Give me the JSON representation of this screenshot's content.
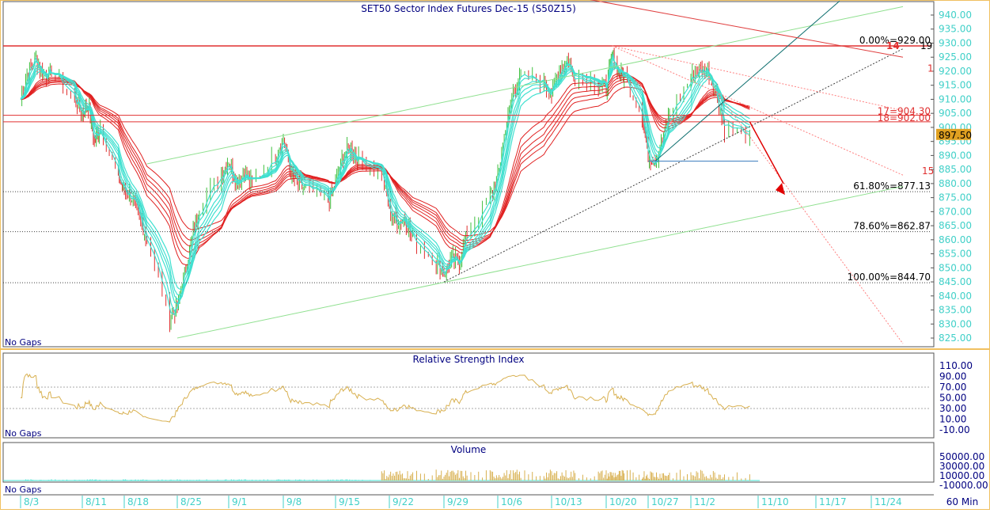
{
  "chart_data": [
    {
      "type": "line",
      "title": "SET50 Sector Index Futures Dec-15 (S50Z15)",
      "panel_note": "No Gaps",
      "timeframe": "60 Min",
      "x_ticks": [
        "8/3",
        "8/11",
        "8/18",
        "8/25",
        "9/1",
        "9/8",
        "9/15",
        "9/22",
        "9/29",
        "10/6",
        "10/13",
        "10/20",
        "10/27",
        "11/2",
        "11/10",
        "11/17",
        "11/24"
      ],
      "y_ticks": [
        "940.00",
        "935.00",
        "930.00",
        "925.00",
        "920.00",
        "915.00",
        "910.00",
        "905.00",
        "900.00",
        "895.00",
        "890.00",
        "885.00",
        "880.00",
        "875.00",
        "870.00",
        "865.00",
        "860.00",
        "855.00",
        "850.00",
        "845.00",
        "840.00",
        "835.00",
        "830.00",
        "825.00"
      ],
      "ylim": [
        822,
        942
      ],
      "last_price": "897.50",
      "series": [
        {
          "type": "price",
          "points": [
            [
              "8/3",
              910
            ],
            [
              "8/4",
              920
            ],
            [
              "8/5",
              925
            ],
            [
              "8/6",
              918
            ],
            [
              "8/7",
              920
            ],
            [
              "8/10",
              910
            ],
            [
              "8/11",
              905
            ],
            [
              "8/12",
              908
            ],
            [
              "8/13",
              895
            ],
            [
              "8/14",
              900
            ],
            [
              "8/17",
              882
            ],
            [
              "8/18",
              878
            ],
            [
              "8/19",
              875
            ],
            [
              "8/20",
              868
            ],
            [
              "8/21",
              860
            ],
            [
              "8/24",
              832
            ],
            [
              "8/25",
              836
            ],
            [
              "8/26",
              848
            ],
            [
              "8/27",
              860
            ],
            [
              "8/28",
              872
            ],
            [
              "8/31",
              884
            ],
            [
              "9/1",
              888
            ],
            [
              "9/2",
              880
            ],
            [
              "9/3",
              884
            ],
            [
              "9/4",
              880
            ],
            [
              "9/7",
              890
            ],
            [
              "9/8",
              896
            ],
            [
              "9/9",
              884
            ],
            [
              "9/10",
              880
            ],
            [
              "9/11",
              878
            ],
            [
              "9/14",
              874
            ],
            [
              "9/15",
              880
            ],
            [
              "9/16",
              890
            ],
            [
              "9/17",
              893
            ],
            [
              "9/18",
              888
            ],
            [
              "9/21",
              885
            ],
            [
              "9/22",
              870
            ],
            [
              "9/23",
              866
            ],
            [
              "9/24",
              868
            ],
            [
              "9/25",
              860
            ],
            [
              "9/28",
              852
            ],
            [
              "9/29",
              848
            ],
            [
              "9/30",
              853
            ],
            [
              "10/1",
              852
            ],
            [
              "10/2",
              862
            ],
            [
              "10/5",
              875
            ],
            [
              "10/6",
              882
            ],
            [
              "10/7",
              900
            ],
            [
              "10/8",
              912
            ],
            [
              "10/9",
              918
            ],
            [
              "10/12",
              916
            ],
            [
              "10/13",
              912
            ],
            [
              "10/14",
              920
            ],
            [
              "10/15",
              924
            ],
            [
              "10/16",
              918
            ],
            [
              "10/19",
              916
            ],
            [
              "10/20",
              914
            ],
            [
              "10/21",
              926
            ],
            [
              "10/22",
              920
            ],
            [
              "10/23",
              918
            ],
            [
              "10/26",
              905
            ],
            [
              "10/27",
              890
            ],
            [
              "10/28",
              888
            ],
            [
              "10/29",
              895
            ],
            [
              "10/30",
              905
            ],
            [
              "11/2",
              918
            ],
            [
              "11/3",
              920
            ],
            [
              "11/4",
              921
            ],
            [
              "11/5",
              912
            ],
            [
              "11/6",
              900
            ],
            [
              "11/9",
              897.5
            ]
          ]
        },
        {
          "type": "rsi",
          "name": "Relative Strength Index",
          "y_ticks": [
            "110.00",
            "90.00",
            "70.00",
            "50.00",
            "30.00",
            "10.00",
            "-10.00"
          ],
          "ylim": [
            -10,
            110
          ],
          "guides": [
            70,
            30
          ]
        },
        {
          "type": "volume",
          "name": "Volume",
          "y_ticks": [
            "50000.00",
            "30000.00",
            "10000.00",
            "-10000.00"
          ],
          "ylim": [
            -10000,
            50000
          ]
        }
      ],
      "fib_levels": [
        {
          "label": "0.00%=929.00",
          "price": 929.0
        },
        {
          "label": "61.80%=877.13",
          "price": 877.13
        },
        {
          "label": "78.60%=862.87",
          "price": 862.87
        },
        {
          "label": "100.00%=844.70",
          "price": 844.7
        }
      ],
      "horizontal_levels": [
        {
          "label": "17=904.30",
          "price": 904.3
        },
        {
          "label": "18=902.00",
          "price": 902.0
        }
      ],
      "line_labels": [
        "14",
        "19",
        "1",
        "15"
      ],
      "trendlines": [
        {
          "kind": "channel-upper",
          "color": "#90e090",
          "from": [
            "8/21",
            887
          ]
        }
      ],
      "colors": {
        "price": "#40e0d0",
        "ma_long": "#e02020",
        "rsi": "#d8b050",
        "axis_text": "#40d0c8",
        "title_text": "#000080",
        "border": "#f0c060",
        "fib": "#404040",
        "level": "#e03030"
      }
    }
  ]
}
